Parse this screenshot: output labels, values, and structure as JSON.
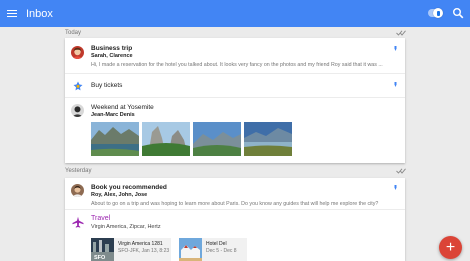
{
  "app": {
    "title": "Inbox",
    "accent": "#4285f4",
    "fab_color": "#db4437",
    "fab_icon": "+"
  },
  "sections": [
    {
      "label": "Today",
      "items": [
        {
          "subject": "Business trip",
          "from": "Sarah, Clarence",
          "snippet": "Hi, I made a reservation for the hotel you talked about. It looks very fancy on the photos and my friend Roy said that it was ..."
        },
        {
          "subject": "Buy tickets"
        },
        {
          "subject": "Weekend at Yosemite",
          "from": "Jean-Marc Denis"
        }
      ]
    },
    {
      "label": "Yesterday",
      "items": [
        {
          "subject": "Book you recommended",
          "from": "Roy, Alex, John, Jose",
          "snippet": "About to go on a trip and was hoping to learn more about Paris. Do you know any guides that will help me explore the city?"
        },
        {
          "subject": "Travel",
          "from": "Virgin America, Zipcar, Hertz",
          "flight": {
            "airline": "Virgin America 1281",
            "route": "SFO-JFK, Jan 13, 8:23",
            "badge": "SFO"
          },
          "hotel": {
            "name": "Hotel Del",
            "dates": "Dec 5 - Dec 8"
          }
        }
      ]
    }
  ]
}
